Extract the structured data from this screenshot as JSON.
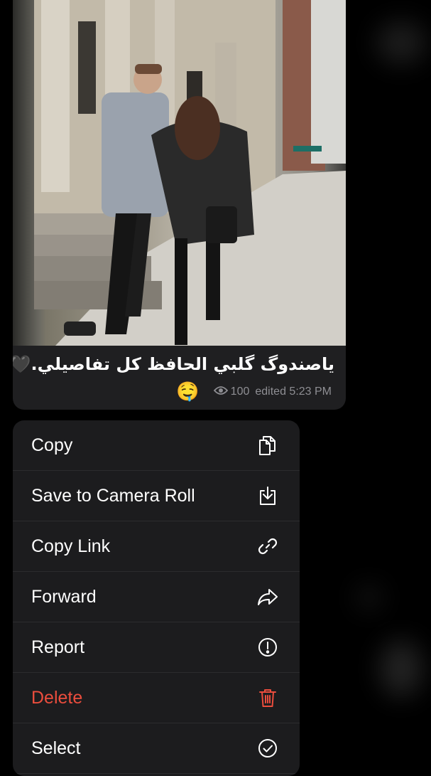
{
  "post": {
    "caption": "ياصندوگ گلبي الحافظ كل تفاصيلي.🖤",
    "emoji": "🤤",
    "views": "100",
    "edited_time": "edited 5:23 PM"
  },
  "menu": {
    "items": [
      {
        "label": "Copy",
        "icon": "copy-icon"
      },
      {
        "label": "Save to Camera Roll",
        "icon": "save-icon"
      },
      {
        "label": "Copy Link",
        "icon": "link-icon"
      },
      {
        "label": "Forward",
        "icon": "forward-icon"
      },
      {
        "label": "Report",
        "icon": "report-icon"
      },
      {
        "label": "Delete",
        "icon": "trash-icon"
      },
      {
        "label": "Select",
        "icon": "select-check-icon"
      }
    ]
  },
  "colors": {
    "background": "#000000",
    "menu_background": "#1c1c1e",
    "danger": "#eb4d3d",
    "meta_text": "#8e8e93"
  }
}
